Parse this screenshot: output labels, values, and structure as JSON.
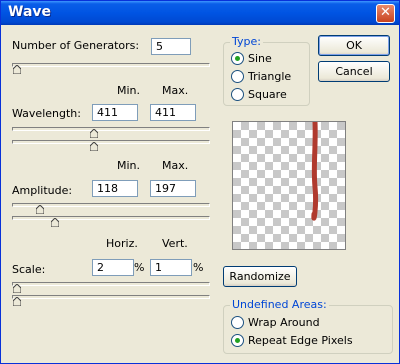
{
  "window": {
    "title": "Wave"
  },
  "generators": {
    "label": "Number of Generators:",
    "value": "5",
    "slider_fraction": 0.0
  },
  "col_headers": {
    "min": "Min.",
    "max": "Max.",
    "horiz": "Horiz.",
    "vert": "Vert."
  },
  "wavelength": {
    "label": "Wavelength:",
    "min": "411",
    "max": "411",
    "min_slider_fraction": 0.41,
    "max_slider_fraction": 0.41
  },
  "amplitude": {
    "label": "Amplitude:",
    "min": "118",
    "max": "197",
    "min_slider_fraction": 0.12,
    "max_slider_fraction": 0.2
  },
  "scale": {
    "label": "Scale:",
    "horiz": "2",
    "vert": "1",
    "unit": "%",
    "horiz_slider_fraction": 0.0,
    "vert_slider_fraction": 0.0
  },
  "type": {
    "title": "Type:",
    "options": [
      "Sine",
      "Triangle",
      "Square"
    ],
    "selected": "Sine"
  },
  "buttons": {
    "ok": "OK",
    "cancel": "Cancel",
    "randomize": "Randomize"
  },
  "undefined_areas": {
    "title": "Undefined Areas:",
    "options": [
      "Wrap Around",
      "Repeat Edge Pixels"
    ],
    "selected": "Repeat Edge Pixels"
  },
  "colors": {
    "wave_stroke": "#b03a2e",
    "title_bar": "#0054e3",
    "radio_dot": "#21a121"
  }
}
